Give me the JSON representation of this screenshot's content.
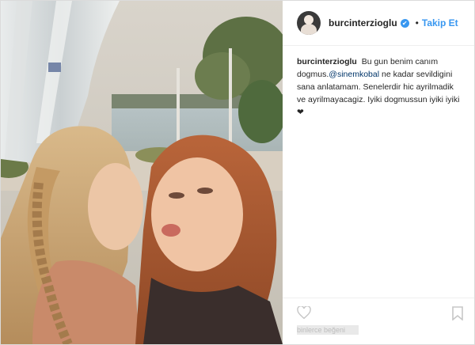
{
  "post": {
    "username": "burcinterzioglu",
    "verified_badge": "✔",
    "separator": "•",
    "follow_label": "Takip Et",
    "caption": {
      "username": "burcinterzioglu",
      "text_1": "Bu gun benim canım dogmus.",
      "mention": "@sinemkobal",
      "text_2": " ne kadar sevildigini sana anlatamam. Senelerdir hic ayrilmadik ve ayrilmayacagiz. Iyiki dogmussun iyiki iyiki❤"
    },
    "likes_text": "binlerce beğeni"
  },
  "icons": {
    "like": "heart-icon",
    "save": "bookmark-icon",
    "avatar": "profile-avatar"
  },
  "colors": {
    "accent": "#3897f0",
    "text": "#262626",
    "mention": "#003569"
  }
}
